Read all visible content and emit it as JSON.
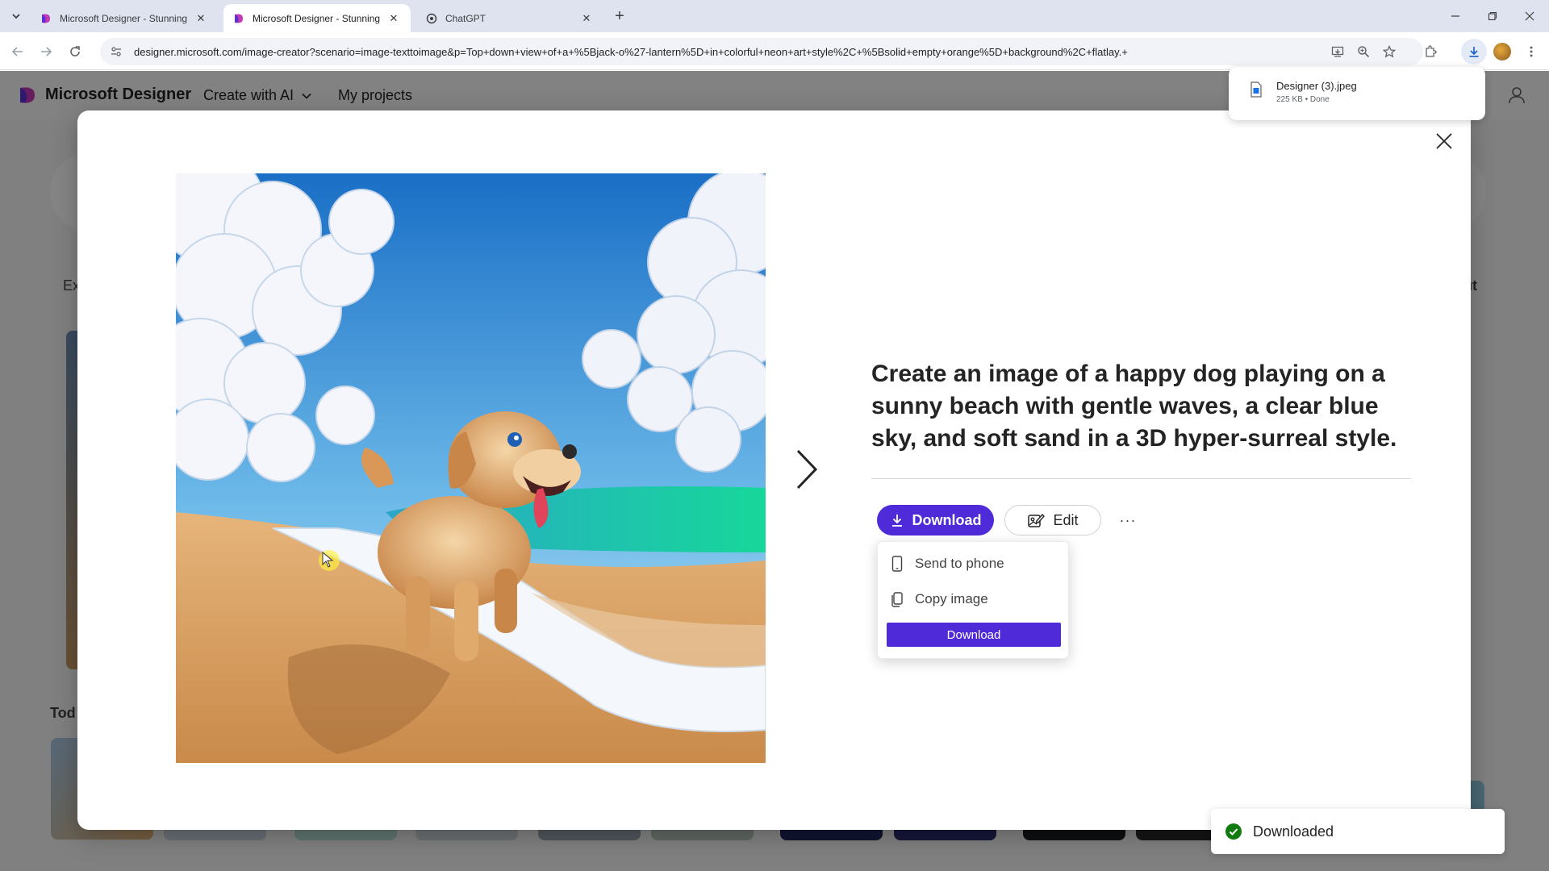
{
  "browser": {
    "tabs": [
      {
        "title": "Microsoft Designer - Stunning",
        "active": false
      },
      {
        "title": "Microsoft Designer - Stunning",
        "active": true
      },
      {
        "title": "ChatGPT",
        "active": false
      }
    ],
    "url": "designer.microsoft.com/image-creator?scenario=image-texttoimage&p=Top+down+view+of+a+%5Bjack-o%27-lantern%5D+in+colorful+neon+art+style%2C+%5Bsolid+empty+orange%5D+background%2C+flatlay.+"
  },
  "download_bubble": {
    "file_name": "Designer (3).jpeg",
    "meta": "225 KB • Done"
  },
  "app": {
    "name": "Microsoft Designer",
    "nav": {
      "create": "Create with AI",
      "projects": "My projects"
    },
    "bg_left_text": "Ex",
    "bg_right_text": "ut",
    "bg_today_text": "Tod"
  },
  "dialog": {
    "prompt": "Create an image of a happy dog playing on a sunny beach with gentle waves, a clear blue sky, and soft sand in a 3D hyper-surreal style.",
    "download_label": "Download",
    "edit_label": "Edit",
    "more_label": "···",
    "menu": {
      "send_to_phone": "Send to phone",
      "copy_image": "Copy image",
      "download": "Download"
    }
  },
  "toast": {
    "message": "Downloaded"
  },
  "colors": {
    "accent": "#4f2ad8",
    "success": "#107c10"
  },
  "icons": [
    "search-tabs-icon",
    "designer-favicon",
    "chatgpt-favicon",
    "close-icon",
    "plus-icon",
    "minimize-icon",
    "restore-icon",
    "back-icon",
    "forward-icon",
    "reload-icon",
    "site-info-icon",
    "install-app-icon",
    "zoom-icon",
    "star-icon",
    "extensions-icon",
    "download-icon",
    "menu-dots-icon",
    "chevron-down-icon",
    "chevron-right-icon",
    "edit-icon",
    "phone-icon",
    "copy-icon",
    "check-circle-icon",
    "file-icon"
  ]
}
